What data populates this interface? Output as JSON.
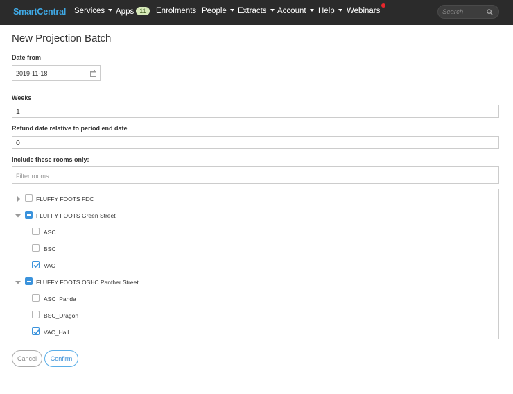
{
  "navbar": {
    "brand": "SmartCentral",
    "items": {
      "services": "Services",
      "apps": "Apps",
      "apps_badge": "11",
      "enrolments": "Enrolments",
      "people": "People",
      "extracts": "Extracts",
      "account": "Account",
      "help": "Help",
      "webinars": "Webinars"
    },
    "search_placeholder": "Search",
    "colors": {
      "background": "#2b2b2b",
      "brand": "#3fa9e6",
      "notification": "#e8262c",
      "badge": "#d6e9b8"
    }
  },
  "page": {
    "title": "New Projection Batch"
  },
  "form": {
    "date_from": {
      "label": "Date from",
      "value": "2019-11-18",
      "icon": "calendar-icon"
    },
    "weeks": {
      "label": "Weeks",
      "value": "1"
    },
    "refund": {
      "label": "Refund date relative to period end date",
      "value": "0"
    },
    "rooms": {
      "label": "Include these rooms only:",
      "filter_placeholder": "Filter rooms"
    }
  },
  "tree": {
    "nodes": [
      {
        "label": "FLUFFY FOOTS FDC",
        "level": 0,
        "expanded": false,
        "state": "unchecked"
      },
      {
        "label": "FLUFFY FOOTS Green Street",
        "level": 0,
        "expanded": true,
        "state": "indeterminate"
      },
      {
        "label": "ASC",
        "level": 1,
        "state": "unchecked"
      },
      {
        "label": "BSC",
        "level": 1,
        "state": "unchecked"
      },
      {
        "label": "VAC",
        "level": 1,
        "state": "checked"
      },
      {
        "label": "FLUFFY FOOTS OSHC Panther Street",
        "level": 0,
        "expanded": true,
        "state": "indeterminate"
      },
      {
        "label": "ASC_Panda",
        "level": 1,
        "state": "unchecked"
      },
      {
        "label": "BSC_Dragon",
        "level": 1,
        "state": "unchecked"
      },
      {
        "label": "VAC_Hall",
        "level": 1,
        "state": "checked"
      }
    ],
    "colors": {
      "checkbox_active": "#3b93dc"
    }
  },
  "buttons": {
    "cancel": "Cancel",
    "confirm": "Confirm"
  }
}
